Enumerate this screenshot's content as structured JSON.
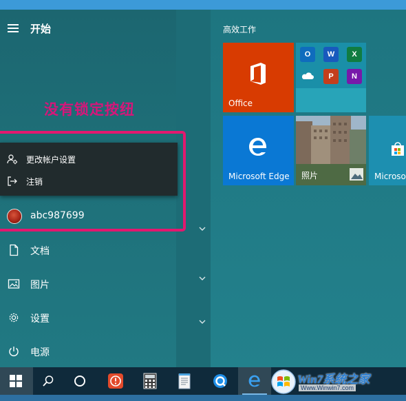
{
  "start_menu": {
    "title": "开始",
    "annotation": "没有锁定按纽",
    "flyout": {
      "items": [
        {
          "label": "更改帐户设置",
          "icon": "account-settings-icon"
        },
        {
          "label": "注销",
          "icon": "sign-out-icon"
        }
      ]
    },
    "user": {
      "name": "abc987699"
    },
    "nav": [
      {
        "label": "文档",
        "icon": "document-icon"
      },
      {
        "label": "图片",
        "icon": "pictures-icon"
      },
      {
        "label": "设置",
        "icon": "gear-icon"
      },
      {
        "label": "电源",
        "icon": "power-icon"
      }
    ]
  },
  "tiles": {
    "group_title": "高效工作",
    "office": "Office",
    "edge": "Microsoft Edge",
    "photos": "照片",
    "store": "Microsof"
  },
  "office_apps": [
    "O",
    "W",
    "X",
    "",
    "P",
    "N"
  ],
  "taskbar": {
    "buttons": [
      "windows-start-icon",
      "search-icon",
      "cortana-icon",
      "app-red-icon",
      "calculator-icon",
      "notepad-icon",
      "browser-q-icon",
      "edge-icon"
    ]
  },
  "watermark": {
    "text": "Win7系统之家",
    "url": "Www.Winwin7.com"
  },
  "colors": {
    "office": "#d83b01",
    "edge": "#0a78d4",
    "annotation": "#d6167a",
    "highlight": "#e3186f",
    "taskbar": "#0f2a3b"
  }
}
